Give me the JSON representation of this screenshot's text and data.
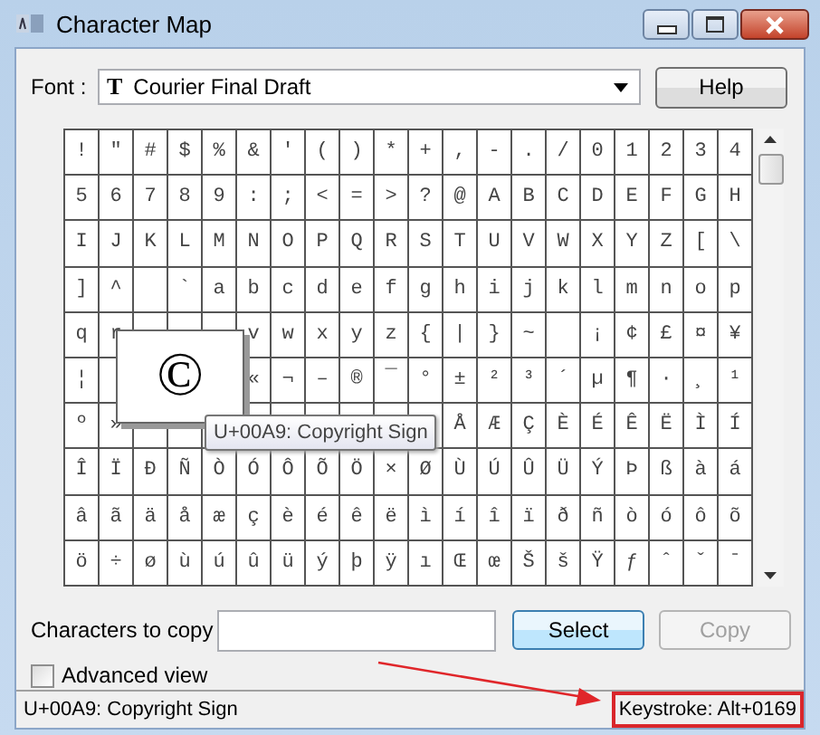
{
  "window": {
    "title": "Character Map"
  },
  "font": {
    "label": "Font :",
    "type_icon": "T",
    "value": "Courier Final Draft"
  },
  "help_button": "Help",
  "grid": {
    "rows": [
      [
        "!",
        "\"",
        "#",
        "$",
        "%",
        "&",
        "'",
        "(",
        ")",
        "*",
        "+",
        ",",
        "-",
        ".",
        "/",
        "0",
        "1",
        "2",
        "3",
        "4"
      ],
      [
        "5",
        "6",
        "7",
        "8",
        "9",
        ":",
        ";",
        "<",
        "=",
        ">",
        "?",
        "@",
        "A",
        "B",
        "C",
        "D",
        "E",
        "F",
        "G",
        "H"
      ],
      [
        "I",
        "J",
        "K",
        "L",
        "M",
        "N",
        "O",
        "P",
        "Q",
        "R",
        "S",
        "T",
        "U",
        "V",
        "W",
        "X",
        "Y",
        "Z",
        "[",
        "\\"
      ],
      [
        "]",
        "^",
        {
          "kind": "blank"
        },
        "`",
        "a",
        "b",
        "c",
        "d",
        "e",
        "f",
        "g",
        "h",
        "i",
        "j",
        "k",
        "l",
        "m",
        "n",
        "o",
        "p"
      ],
      [
        "q",
        "r",
        null,
        null,
        null,
        "v",
        "w",
        "x",
        "y",
        "z",
        "{",
        "|",
        "}",
        "~",
        {
          "kind": "blank"
        },
        "¡",
        "¢",
        "£",
        "¤",
        "¥"
      ],
      [
        "¦",
        null,
        null,
        null,
        null,
        "«",
        "¬",
        "–",
        "®",
        "¯",
        "°",
        "±",
        "²",
        "³",
        "´",
        "µ",
        "¶",
        "·",
        "¸",
        "¹"
      ],
      [
        "º",
        "»",
        null,
        null,
        null,
        null,
        null,
        null,
        null,
        null,
        null,
        "Å",
        "Æ",
        "Ç",
        "È",
        "É",
        "Ê",
        "Ë",
        "Ì",
        "Í"
      ],
      [
        "Î",
        "Ï",
        "Ð",
        "Ñ",
        "Ò",
        "Ó",
        "Ô",
        "Õ",
        "Ö",
        "×",
        "Ø",
        "Ù",
        "Ú",
        "Û",
        "Ü",
        "Ý",
        "Þ",
        "ß",
        "à",
        "á"
      ],
      [
        "â",
        "ã",
        "ä",
        "å",
        "æ",
        "ç",
        "è",
        "é",
        "ê",
        "ë",
        "ì",
        "í",
        "î",
        "ï",
        "ð",
        "ñ",
        "ò",
        "ó",
        "ô",
        "õ"
      ],
      [
        "ö",
        "÷",
        "ø",
        "ù",
        "ú",
        "û",
        "ü",
        "ý",
        "þ",
        "ÿ",
        "ı",
        "Œ",
        "œ",
        "Š",
        "š",
        "Ÿ",
        "ƒ",
        "ˆ",
        "ˇ",
        "ˉ"
      ]
    ],
    "enlarged": "©",
    "tooltip": "U+00A9: Copyright Sign"
  },
  "copy_row": {
    "label": "Characters to copy"
  },
  "select_button": "Select",
  "copy_button": {
    "label": "Copy",
    "disabled": true
  },
  "advanced_view": {
    "label": "Advanced view",
    "checked": false
  },
  "status_bar": {
    "text": "U+00A9: Copyright Sign",
    "keystroke": "Keystroke: Alt+0169"
  }
}
